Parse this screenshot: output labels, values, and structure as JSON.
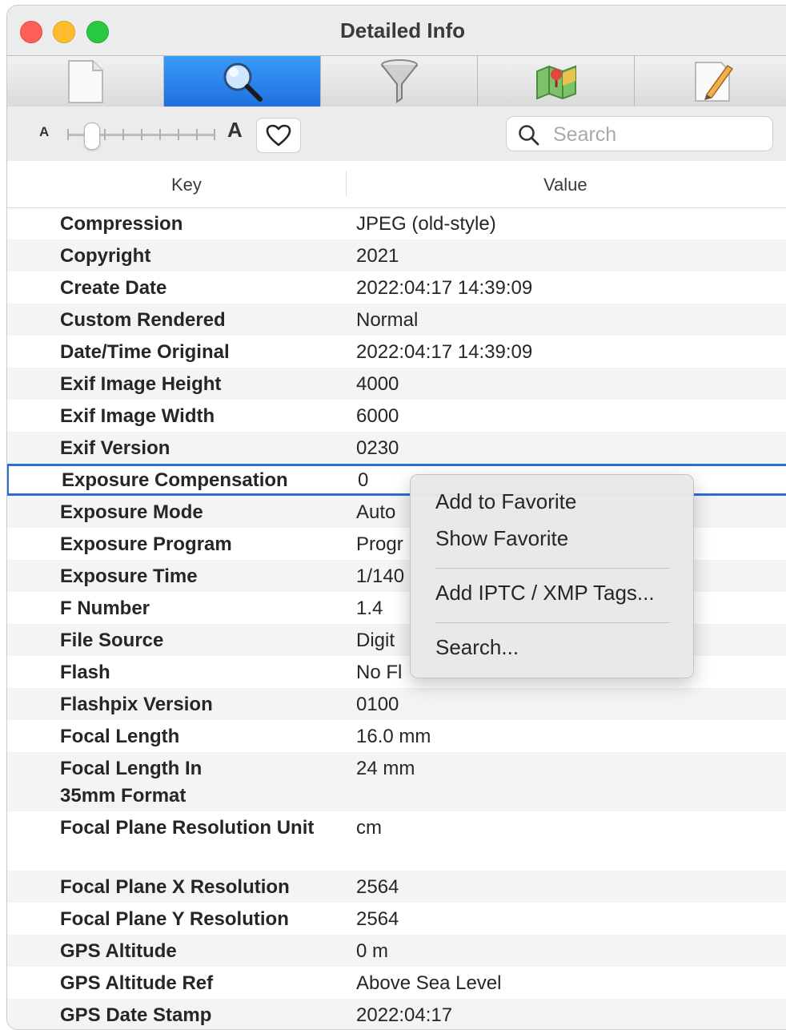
{
  "window": {
    "title": "Detailed Info"
  },
  "tabs": [
    {
      "icon": "document-icon"
    },
    {
      "icon": "magnifier-icon",
      "active": true
    },
    {
      "icon": "funnel-icon"
    },
    {
      "icon": "map-icon"
    },
    {
      "icon": "notepad-pencil-icon"
    }
  ],
  "toolbar": {
    "font_small_label": "A",
    "font_large_label": "A",
    "font_size_level": 0.15,
    "search_placeholder": "Search"
  },
  "table": {
    "columns": {
      "key": "Key",
      "value": "Value"
    },
    "rows": [
      {
        "key": "Compression",
        "value": "JPEG (old-style)"
      },
      {
        "key": "Copyright",
        "value": "2021"
      },
      {
        "key": "Create Date",
        "value": "2022:04:17 14:39:09"
      },
      {
        "key": "Custom Rendered",
        "value": "Normal"
      },
      {
        "key": "Date/Time Original",
        "value": "2022:04:17 14:39:09"
      },
      {
        "key": "Exif Image Height",
        "value": "4000"
      },
      {
        "key": "Exif Image Width",
        "value": "6000"
      },
      {
        "key": "Exif Version",
        "value": "0230"
      },
      {
        "key": "Exposure Compensation",
        "value": "0",
        "selected": true
      },
      {
        "key": "Exposure Mode",
        "value": "Auto"
      },
      {
        "key": "Exposure Program",
        "value": "Progr"
      },
      {
        "key": "Exposure Time",
        "value": "1/140"
      },
      {
        "key": "F Number",
        "value": "1.4"
      },
      {
        "key": "File Source",
        "value": "Digit"
      },
      {
        "key": "Flash",
        "value": "No Fl"
      },
      {
        "key": "Flashpix Version",
        "value": "0100"
      },
      {
        "key": "Focal Length",
        "value": "16.0 mm"
      },
      {
        "key": "Focal Length In\n35mm Format",
        "value": "24 mm",
        "tall": true
      },
      {
        "key": "Focal Plane Resolution Unit",
        "value": "cm",
        "tall": true
      },
      {
        "key": "Focal Plane X Resolution",
        "value": "2564"
      },
      {
        "key": "Focal Plane Y Resolution",
        "value": "2564"
      },
      {
        "key": "GPS Altitude",
        "value": "0 m"
      },
      {
        "key": "GPS Altitude Ref",
        "value": "Above Sea Level"
      },
      {
        "key": "GPS Date Stamp",
        "value": "2022:04:17"
      }
    ]
  },
  "context_menu": {
    "items": [
      {
        "label": "Add to Favorite"
      },
      {
        "label": "Show Favorite"
      },
      {
        "separator": true
      },
      {
        "label": "Add IPTC / XMP Tags..."
      },
      {
        "separator": true
      },
      {
        "label": "Search..."
      }
    ]
  },
  "colors": {
    "accent": "#1f6fdd",
    "selection_border": "#2c6fd5",
    "traffic_close": "#fe5f57",
    "traffic_minimize": "#febc2e",
    "traffic_zoom": "#28c840"
  }
}
